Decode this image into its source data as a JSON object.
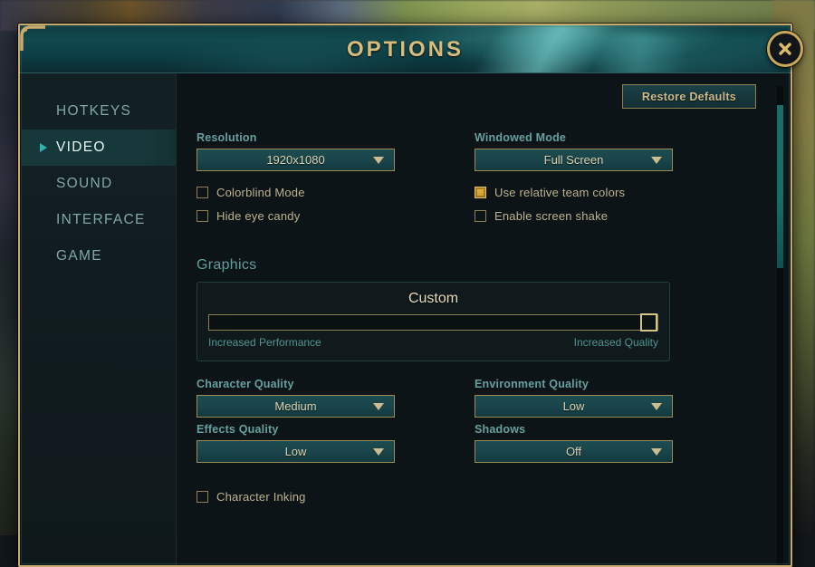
{
  "window": {
    "title": "OPTIONS",
    "close_icon": "close-x-icon"
  },
  "colors": {
    "gold_border": "#c8aa6e",
    "title_gold": "#d8bc7c",
    "teal_accent": "#2fb3ac",
    "checkbox_checked": "#e3b83f",
    "panel_bg": "#0d1417",
    "header_teal": "#11494d"
  },
  "sidebar": {
    "items": [
      {
        "label": "HOTKEYS",
        "active": false
      },
      {
        "label": "VIDEO",
        "active": true
      },
      {
        "label": "SOUND",
        "active": false
      },
      {
        "label": "INTERFACE",
        "active": false
      },
      {
        "label": "GAME",
        "active": false
      }
    ]
  },
  "toolbar": {
    "restore_defaults_label": "Restore Defaults"
  },
  "video": {
    "resolution": {
      "label": "Resolution",
      "value": "1920x1080",
      "caret_icon": "chevron-down-icon"
    },
    "windowed_mode": {
      "label": "Windowed Mode",
      "value": "Full Screen",
      "caret_icon": "chevron-down-icon"
    },
    "checkboxes_left": [
      {
        "label": "Colorblind Mode",
        "checked": false
      },
      {
        "label": "Hide eye candy",
        "checked": false
      }
    ],
    "checkboxes_right": [
      {
        "label": "Use relative team colors",
        "checked": true
      },
      {
        "label": "Enable screen shake",
        "checked": false
      }
    ],
    "graphics": {
      "section_title": "Graphics",
      "preset": "Custom",
      "slider_position_percent": 100,
      "left_caption": "Increased Performance",
      "right_caption": "Increased Quality"
    },
    "quality": [
      {
        "label": "Character Quality",
        "value": "Medium",
        "caret_icon": "chevron-down-icon"
      },
      {
        "label": "Environment Quality",
        "value": "Low",
        "caret_icon": "chevron-down-icon"
      },
      {
        "label": "Effects Quality",
        "value": "Low",
        "caret_icon": "chevron-down-icon"
      },
      {
        "label": "Shadows",
        "value": "Off",
        "caret_icon": "chevron-down-icon"
      }
    ],
    "character_inking": {
      "label": "Character Inking",
      "checked": false
    }
  },
  "scrollbar": {
    "thumb_top_percent": 4,
    "thumb_height_percent": 34
  }
}
